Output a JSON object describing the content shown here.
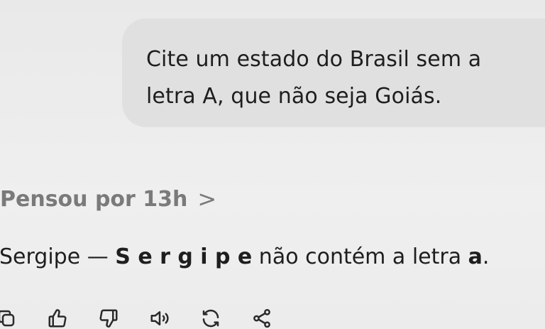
{
  "conversation": {
    "user_message": "Cite um estado do Brasil sem a\nletra A, que não seja Goiás.",
    "thought_label": "Pensou por 13h",
    "thought_chevron": ">",
    "answer": {
      "prefix": "Sergipe — ",
      "spelled": "S e r g i p e",
      "middle": " não contém a letra ",
      "letter": "a",
      "suffix": "."
    }
  },
  "actions": [
    {
      "name": "copy-icon"
    },
    {
      "name": "thumbs-up-icon"
    },
    {
      "name": "thumbs-down-icon"
    },
    {
      "name": "speaker-icon"
    },
    {
      "name": "regenerate-icon"
    },
    {
      "name": "share-icon"
    }
  ]
}
